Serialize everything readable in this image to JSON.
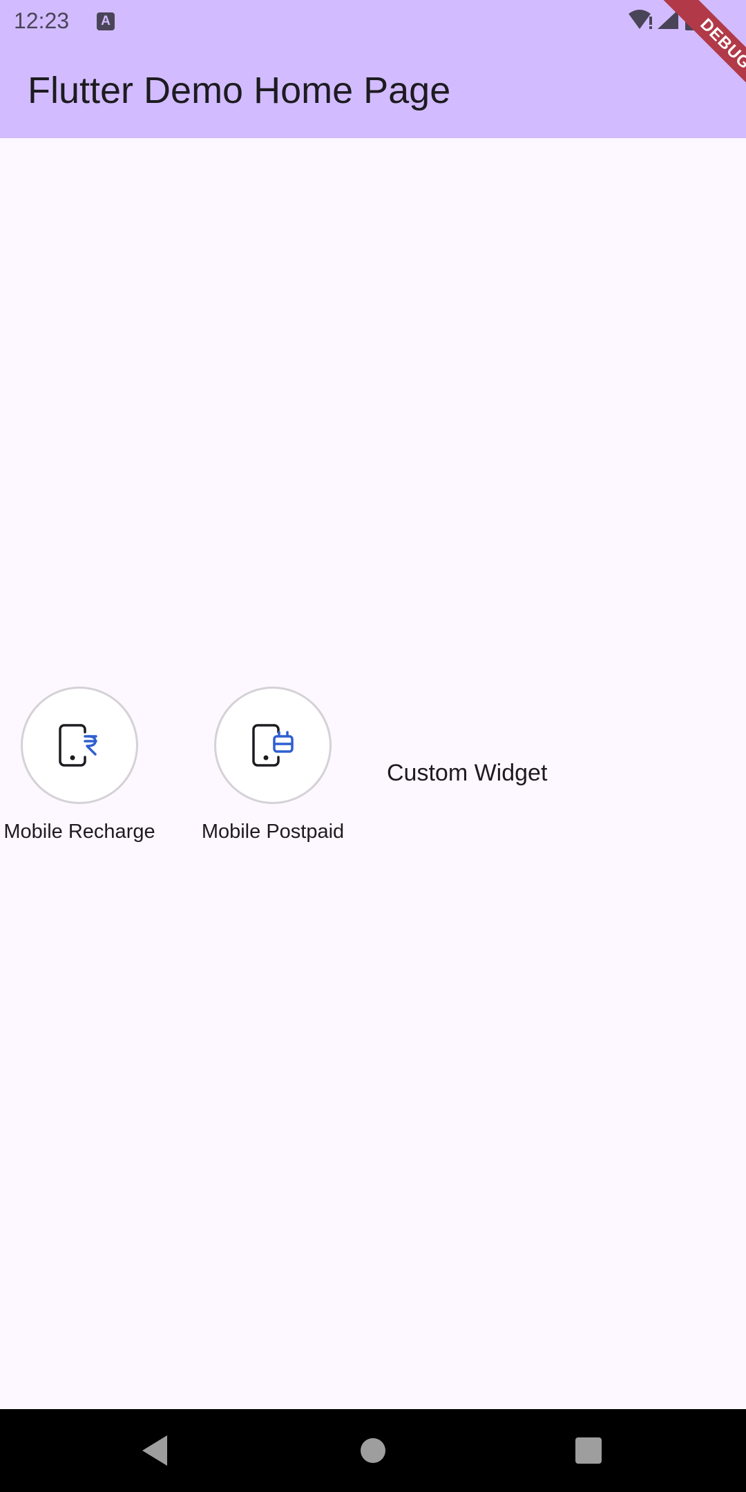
{
  "status_bar": {
    "time": "12:23",
    "keyboard_indicator": "A",
    "icons": [
      "wifi-alert-icon",
      "signal-icon",
      "battery-icon"
    ]
  },
  "app_bar": {
    "title": "Flutter Demo Home Page",
    "debug_banner": "DEBUG"
  },
  "items": [
    {
      "label": "Mobile Recharge",
      "icon": "mobile-rupee-icon"
    },
    {
      "label": "Mobile Postpaid",
      "icon": "mobile-bill-icon"
    }
  ],
  "custom_widget": {
    "text": "Custom Widget"
  },
  "nav_bar": {
    "buttons": [
      "back-icon",
      "home-icon",
      "recents-icon"
    ]
  },
  "colors": {
    "app_bar_bg": "#d2bcff",
    "page_bg": "#fdf7ff",
    "icon_accent": "#2f5fd0",
    "debug_banner": "#b23a48"
  }
}
